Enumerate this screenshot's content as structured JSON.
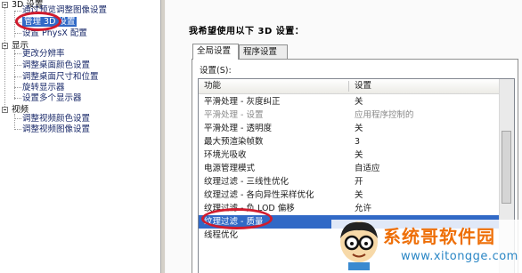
{
  "nav": {
    "sections": [
      {
        "label": "3D 设置",
        "items": [
          {
            "label": "通过预览调整图像设置"
          },
          {
            "label": "管理 3D 设置",
            "selected": true
          },
          {
            "label": "设置 PhysX 配置"
          }
        ]
      },
      {
        "label": "显示",
        "items": [
          {
            "label": "更改分辨率"
          },
          {
            "label": "调整桌面颜色设置"
          },
          {
            "label": "调整桌面尺寸和位置"
          },
          {
            "label": "旋转显示器"
          },
          {
            "label": "设置多个显示器"
          }
        ]
      },
      {
        "label": "视频",
        "items": [
          {
            "label": "调整视频颜色设置"
          },
          {
            "label": "调整视频图像设置"
          }
        ]
      }
    ]
  },
  "main": {
    "heading": "我希望使用以下 3D 设置：",
    "tabs": [
      {
        "label": "全局设置",
        "active": true
      },
      {
        "label": "程序设置",
        "active": false
      }
    ],
    "settings_label": "设置(S):",
    "columns": {
      "feature": "功能",
      "setting": "设置"
    },
    "rows": [
      {
        "feature": "平滑处理 - 灰度纠正",
        "value": "关",
        "disabled": false
      },
      {
        "feature": "平滑处理 - 设置",
        "value": "应用程序控制的",
        "disabled": true
      },
      {
        "feature": "平滑处理 - 透明度",
        "value": "关",
        "disabled": false
      },
      {
        "feature": "最大预渲染帧数",
        "value": "3",
        "disabled": false
      },
      {
        "feature": "环境光吸收",
        "value": "关",
        "disabled": false
      },
      {
        "feature": "电源管理模式",
        "value": "自适应",
        "disabled": false
      },
      {
        "feature": "纹理过滤 - 三线性优化",
        "value": "开",
        "disabled": false
      },
      {
        "feature": "纹理过滤 - 各向异性采样优化",
        "value": "关",
        "disabled": false
      },
      {
        "feature": "纹理过滤 - 负 LOD 偏移",
        "value": "允许",
        "disabled": false
      },
      {
        "feature": "纹理过滤 - 质量",
        "value": "",
        "disabled": false,
        "selected": true
      },
      {
        "feature": "线程优化",
        "value": "",
        "disabled": false
      }
    ]
  },
  "watermark": {
    "title": "系统哥软件园",
    "url": "www.xitongge.com"
  },
  "colors": {
    "selection": "#3169c6",
    "annotation": "#d01c2e",
    "watermark_title": "#ee6f08",
    "watermark_url": "#2a86c5"
  }
}
